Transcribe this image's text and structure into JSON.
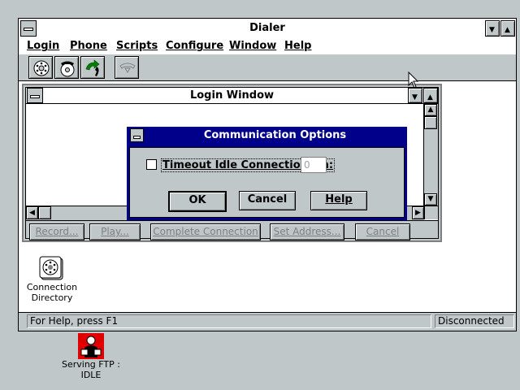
{
  "window": {
    "title": "Dialer"
  },
  "menu": [
    "Login",
    "Phone",
    "Scripts",
    "Configure",
    "Window",
    "Help"
  ],
  "toolbar": {
    "icons": [
      "dial-icon",
      "hangup-icon",
      "phone-handset-icon",
      "phone-disabled-icon"
    ]
  },
  "login_window": {
    "title": "Login Window",
    "buttons": [
      "Record...",
      "Play...",
      "Complete Connection",
      "Set Address...",
      "Cancel"
    ]
  },
  "dialog": {
    "title": "Communication Options",
    "checkbox_label": "Timeout Idle Connections in:",
    "checkbox_checked": false,
    "timeout_value": "0",
    "ok_label": "OK",
    "cancel_label": "Cancel",
    "help_label": "Help"
  },
  "desktop_icons": {
    "connection_directory": "Connection Directory",
    "ftp_line1": "Serving FTP :",
    "ftp_line2": "IDLE"
  },
  "status": {
    "help_text": "For Help, press F1",
    "connection_state": "Disconnected"
  }
}
